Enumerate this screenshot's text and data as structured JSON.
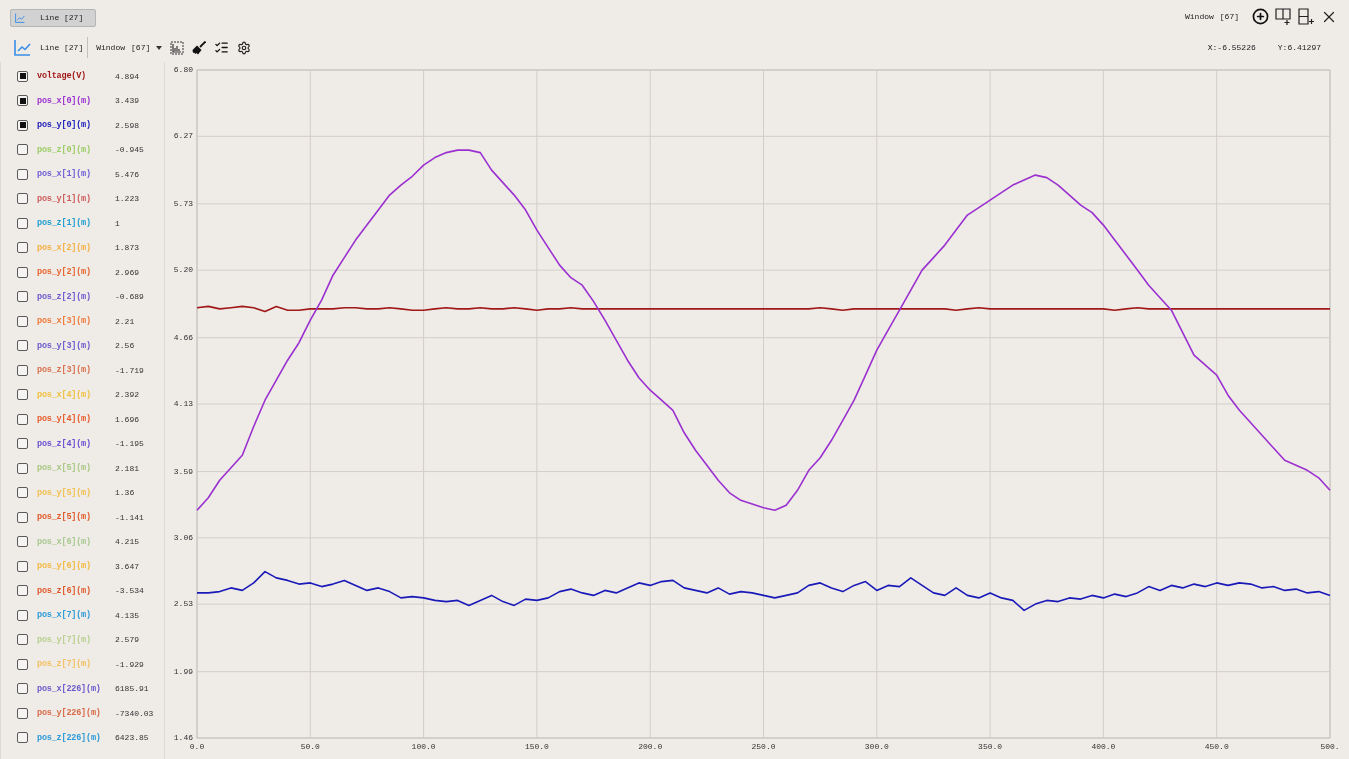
{
  "tabs": [
    {
      "label": "Line [27]",
      "selected": true
    }
  ],
  "window_indicator": {
    "label": "Window",
    "value": "[67]"
  },
  "toolbar": {
    "chart_type": "Line [27]",
    "window_label": "Window",
    "window_value": "[67]"
  },
  "cursor": {
    "x": "X:-6.55226",
    "y": "Y:6.41297"
  },
  "channels": [
    {
      "name": "voltage(V)",
      "value": "4.894",
      "checked": true,
      "color": "#a01818"
    },
    {
      "name": "pos_x[0](m)",
      "value": "3.439",
      "checked": true,
      "color": "#9b30d0"
    },
    {
      "name": "pos_y[0](m)",
      "value": "2.598",
      "checked": true,
      "color": "#1a1ab8"
    },
    {
      "name": "pos_z[0](m)",
      "value": "-0.945",
      "checked": false,
      "color": "#9ccc65"
    },
    {
      "name": "pos_x[1](m)",
      "value": "5.476",
      "checked": false,
      "color": "#7060d8"
    },
    {
      "name": "pos_y[1](m)",
      "value": "1.223",
      "checked": false,
      "color": "#cd5c5c"
    },
    {
      "name": "pos_z[1](m)",
      "value": "1",
      "checked": false,
      "color": "#1e9ecf"
    },
    {
      "name": "pos_x[2](m)",
      "value": "1.873",
      "checked": false,
      "color": "#f4b042"
    },
    {
      "name": "pos_y[2](m)",
      "value": "2.969",
      "checked": false,
      "color": "#e8632c"
    },
    {
      "name": "pos_z[2](m)",
      "value": "-0.689",
      "checked": false,
      "color": "#6a5acd"
    },
    {
      "name": "pos_x[3](m)",
      "value": "2.21",
      "checked": false,
      "color": "#f07838"
    },
    {
      "name": "pos_y[3](m)",
      "value": "2.56",
      "checked": false,
      "color": "#6a5acd"
    },
    {
      "name": "pos_z[3](m)",
      "value": "-1.719",
      "checked": false,
      "color": "#d8704c"
    },
    {
      "name": "pos_x[4](m)",
      "value": "2.392",
      "checked": false,
      "color": "#f0c040"
    },
    {
      "name": "pos_y[4](m)",
      "value": "1.696",
      "checked": false,
      "color": "#e85a28"
    },
    {
      "name": "pos_z[4](m)",
      "value": "-1.195",
      "checked": false,
      "color": "#6a4fd0"
    },
    {
      "name": "pos_x[5](m)",
      "value": "2.181",
      "checked": false,
      "color": "#a8c880"
    },
    {
      "name": "pos_y[5](m)",
      "value": "1.36",
      "checked": false,
      "color": "#f2c050"
    },
    {
      "name": "pos_z[5](m)",
      "value": "-1.141",
      "checked": false,
      "color": "#e05a28"
    },
    {
      "name": "pos_x[6](m)",
      "value": "4.215",
      "checked": false,
      "color": "#a8c890"
    },
    {
      "name": "pos_y[6](m)",
      "value": "3.647",
      "checked": false,
      "color": "#f2b840"
    },
    {
      "name": "pos_z[6](m)",
      "value": "-3.534",
      "checked": false,
      "color": "#e0582a"
    },
    {
      "name": "pos_x[7](m)",
      "value": "4.135",
      "checked": false,
      "color": "#2b9ad8"
    },
    {
      "name": "pos_y[7](m)",
      "value": "2.579",
      "checked": false,
      "color": "#b8d090"
    },
    {
      "name": "pos_z[7](m)",
      "value": "-1.929",
      "checked": false,
      "color": "#f2c060"
    },
    {
      "name": "pos_x[226](m)",
      "value": "6185.91",
      "checked": false,
      "color": "#6a5acd"
    },
    {
      "name": "pos_y[226](m)",
      "value": "-7340.03",
      "checked": false,
      "color": "#d86a48"
    },
    {
      "name": "pos_z[226](m)",
      "value": "6423.85",
      "checked": false,
      "color": "#2b9ad8"
    }
  ],
  "chart": {
    "chart_data": {
      "type": "line",
      "grid": true,
      "x": [
        0,
        5,
        10,
        15,
        20,
        25,
        30,
        35,
        40,
        45,
        50,
        55,
        60,
        65,
        70,
        75,
        80,
        85,
        90,
        95,
        100,
        105,
        110,
        115,
        120,
        125,
        130,
        135,
        140,
        145,
        150,
        155,
        160,
        165,
        170,
        175,
        180,
        185,
        190,
        195,
        200,
        205,
        210,
        215,
        220,
        225,
        230,
        235,
        240,
        245,
        250,
        255,
        260,
        265,
        270,
        275,
        280,
        285,
        290,
        295,
        300,
        305,
        310,
        315,
        320,
        325,
        330,
        335,
        340,
        345,
        350,
        355,
        360,
        365,
        370,
        375,
        380,
        385,
        390,
        395,
        400,
        405,
        410,
        415,
        420,
        425,
        430,
        435,
        440,
        445,
        450,
        455,
        460,
        465,
        470,
        475,
        480,
        485,
        490,
        495,
        500
      ],
      "series": [
        {
          "color": "#a01818",
          "values": [
            4.9,
            4.91,
            4.89,
            4.9,
            4.91,
            4.9,
            4.87,
            4.91,
            4.88,
            4.88,
            4.89,
            4.89,
            4.89,
            4.9,
            4.9,
            4.89,
            4.89,
            4.9,
            4.89,
            4.88,
            4.88,
            4.89,
            4.9,
            4.89,
            4.89,
            4.9,
            4.89,
            4.89,
            4.9,
            4.89,
            4.88,
            4.89,
            4.89,
            4.9,
            4.89,
            4.89,
            4.89,
            4.89,
            4.89,
            4.89,
            4.89,
            4.89,
            4.89,
            4.89,
            4.89,
            4.89,
            4.89,
            4.89,
            4.89,
            4.89,
            4.89,
            4.89,
            4.89,
            4.89,
            4.89,
            4.9,
            4.89,
            4.88,
            4.89,
            4.89,
            4.89,
            4.89,
            4.89,
            4.89,
            4.89,
            4.89,
            4.89,
            4.88,
            4.89,
            4.9,
            4.89,
            4.89,
            4.89,
            4.89,
            4.89,
            4.89,
            4.89,
            4.89,
            4.89,
            4.89,
            4.89,
            4.88,
            4.89,
            4.9,
            4.89,
            4.89,
            4.89,
            4.89,
            4.89,
            4.89,
            4.89,
            4.89,
            4.89,
            4.89,
            4.89,
            4.89,
            4.89,
            4.89,
            4.89,
            4.89,
            4.89
          ]
        },
        {
          "color": "#9b30d0",
          "values": [
            3.28,
            3.38,
            3.52,
            3.62,
            3.72,
            3.95,
            4.16,
            4.32,
            4.48,
            4.62,
            4.8,
            4.96,
            5.16,
            5.3,
            5.44,
            5.56,
            5.68,
            5.8,
            5.88,
            5.95,
            6.04,
            6.1,
            6.14,
            6.16,
            6.16,
            6.14,
            6.0,
            5.9,
            5.8,
            5.68,
            5.52,
            5.38,
            5.24,
            5.14,
            5.08,
            4.95,
            4.8,
            4.64,
            4.48,
            4.34,
            4.24,
            4.16,
            4.08,
            3.9,
            3.76,
            3.64,
            3.52,
            3.42,
            3.36,
            3.33,
            3.3,
            3.28,
            3.32,
            3.44,
            3.6,
            3.7,
            3.84,
            4.0,
            4.16,
            4.36,
            4.56,
            4.72,
            4.88,
            5.04,
            5.2,
            5.3,
            5.4,
            5.52,
            5.64,
            5.7,
            5.76,
            5.82,
            5.88,
            5.92,
            5.96,
            5.94,
            5.88,
            5.8,
            5.72,
            5.66,
            5.56,
            5.44,
            5.32,
            5.2,
            5.08,
            4.98,
            4.88,
            4.7,
            4.52,
            4.44,
            4.36,
            4.2,
            4.08,
            3.98,
            3.88,
            3.78,
            3.68,
            3.64,
            3.6,
            3.54,
            3.44
          ]
        },
        {
          "color": "#1a1ab8",
          "values": [
            2.62,
            2.62,
            2.63,
            2.66,
            2.64,
            2.7,
            2.79,
            2.74,
            2.72,
            2.69,
            2.7,
            2.67,
            2.69,
            2.72,
            2.68,
            2.64,
            2.66,
            2.63,
            2.58,
            2.59,
            2.58,
            2.56,
            2.55,
            2.56,
            2.52,
            2.56,
            2.6,
            2.55,
            2.52,
            2.57,
            2.56,
            2.58,
            2.63,
            2.65,
            2.62,
            2.6,
            2.64,
            2.62,
            2.66,
            2.7,
            2.68,
            2.71,
            2.72,
            2.66,
            2.64,
            2.62,
            2.66,
            2.61,
            2.63,
            2.62,
            2.6,
            2.58,
            2.6,
            2.62,
            2.68,
            2.7,
            2.66,
            2.63,
            2.68,
            2.71,
            2.64,
            2.68,
            2.67,
            2.74,
            2.68,
            2.62,
            2.6,
            2.66,
            2.6,
            2.58,
            2.62,
            2.58,
            2.56,
            2.48,
            2.53,
            2.56,
            2.55,
            2.58,
            2.57,
            2.6,
            2.58,
            2.61,
            2.59,
            2.62,
            2.67,
            2.64,
            2.68,
            2.66,
            2.69,
            2.67,
            2.7,
            2.68,
            2.7,
            2.69,
            2.66,
            2.67,
            2.64,
            2.65,
            2.62,
            2.63,
            2.6
          ]
        }
      ],
      "xlim": [
        0,
        500
      ],
      "ylim": [
        1.46,
        6.8
      ],
      "xticks": [
        {
          "value": 0,
          "label": "0.0"
        },
        {
          "value": 50,
          "label": "50.0"
        },
        {
          "value": 100,
          "label": "100.0"
        },
        {
          "value": 150,
          "label": "150.0"
        },
        {
          "value": 200,
          "label": "200.0"
        },
        {
          "value": 250,
          "label": "250.0"
        },
        {
          "value": 300,
          "label": "300.0"
        },
        {
          "value": 350,
          "label": "350.0"
        },
        {
          "value": 400,
          "label": "400.0"
        },
        {
          "value": 450,
          "label": "450.0"
        },
        {
          "value": 500,
          "label": "500."
        }
      ],
      "yticks": [
        {
          "value": 1.46,
          "label": "1.46"
        },
        {
          "value": 1.99,
          "label": "1.99"
        },
        {
          "value": 2.53,
          "label": "2.53"
        },
        {
          "value": 3.06,
          "label": "3.06"
        },
        {
          "value": 3.59,
          "label": "3.59"
        },
        {
          "value": 4.13,
          "label": "4.13"
        },
        {
          "value": 4.66,
          "label": "4.66"
        },
        {
          "value": 5.2,
          "label": "5.20"
        },
        {
          "value": 5.73,
          "label": "5.73"
        },
        {
          "value": 6.27,
          "label": "6.27"
        },
        {
          "value": 6.8,
          "label": "6.80"
        }
      ]
    }
  }
}
